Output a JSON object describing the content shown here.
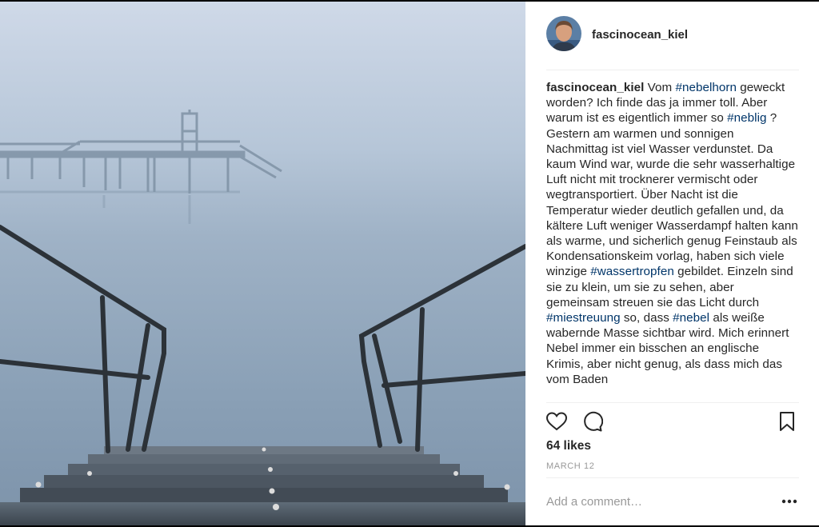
{
  "post": {
    "username": "fascinocean_kiel",
    "caption": [
      {
        "t": "user",
        "v": "fascinocean_kiel"
      },
      {
        "t": "text",
        "v": " Vom "
      },
      {
        "t": "tag",
        "v": "#nebelhorn"
      },
      {
        "t": "text",
        "v": " geweckt worden? Ich finde das ja immer toll. Aber warum ist es eigentlich immer so "
      },
      {
        "t": "tag",
        "v": "#neblig"
      },
      {
        "t": "text",
        "v": " ? Gestern am warmen und sonnigen Nachmittag ist viel Wasser verdunstet. Da kaum Wind war, wurde die sehr wasserhaltige Luft nicht mit trocknerer vermischt oder wegtransportiert. Über Nacht ist die Temperatur wieder deutlich gefallen und, da kältere Luft weniger Wasserdampf halten kann als warme, und sicherlich genug Feinstaub als Kondensationskeim vorlag, haben sich viele winzige "
      },
      {
        "t": "tag",
        "v": "#wassertropfen"
      },
      {
        "t": "text",
        "v": " gebildet. Einzeln sind sie zu klein, um sie zu sehen, aber gemeinsam streuen sie das Licht durch "
      },
      {
        "t": "tag",
        "v": "#miestreuung"
      },
      {
        "t": "text",
        "v": " so, dass "
      },
      {
        "t": "tag",
        "v": "#nebel"
      },
      {
        "t": "text",
        "v": " als weiße wabernde Masse sichtbar wird. Mich erinnert Nebel immer ein bisschen an englische Krimis, aber nicht genug, als dass mich das vom Baden"
      }
    ],
    "likes": "64 likes",
    "date": "March 12",
    "comment_placeholder": "Add a comment…"
  },
  "icons": {
    "avatar": "profile-avatar",
    "like": "heart-icon",
    "comment": "speech-bubble-icon",
    "save": "bookmark-icon",
    "more": "ellipsis-icon"
  },
  "colors": {
    "text": "#262626",
    "hashtag": "#003569",
    "muted": "#999999",
    "divider": "#efefef",
    "fog": "#9fb4c8"
  }
}
